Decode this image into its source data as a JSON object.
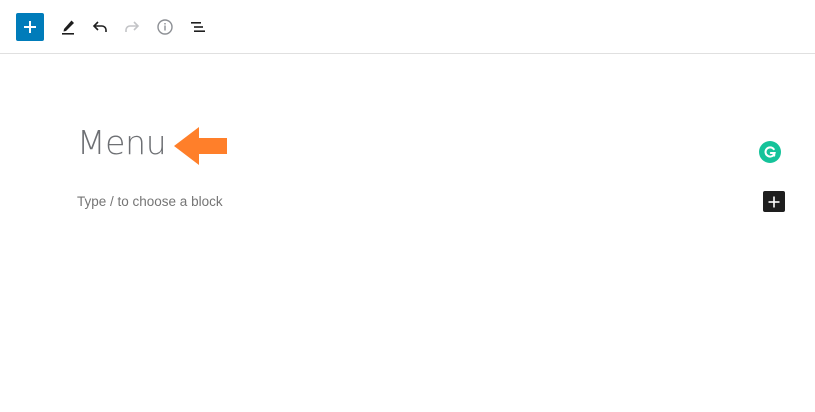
{
  "toolbar": {
    "add_block_icon": "plus-icon",
    "tools_icon": "pencil-icon",
    "undo_icon": "undo-icon",
    "redo_icon": "redo-icon",
    "details_icon": "info-icon",
    "outline_icon": "list-view-icon"
  },
  "editor": {
    "title": "Menu",
    "annotation_icon": "arrow-left-icon",
    "block_placeholder": "Type / to choose a block",
    "grammarly_icon": "grammarly-icon",
    "inline_add_icon": "plus-icon"
  },
  "colors": {
    "accent": "#007cba",
    "annotation_arrow": "#ff7f2a",
    "grammarly": "#15c39a",
    "inline_add_bg": "#1e1e1e"
  }
}
